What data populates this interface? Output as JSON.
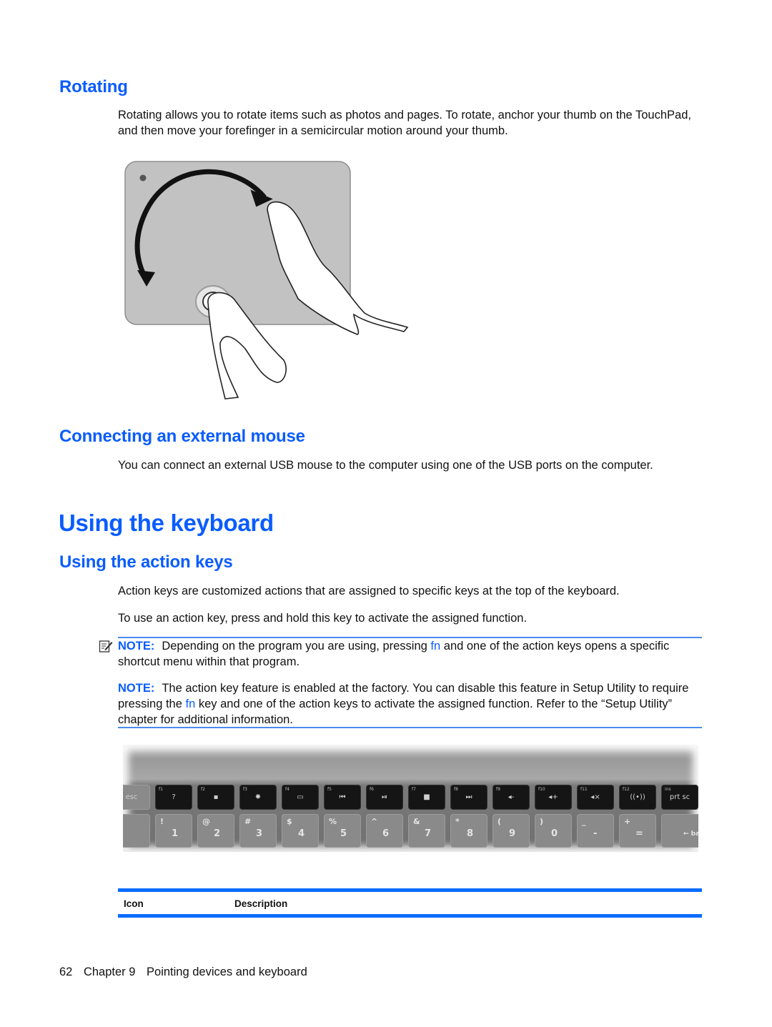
{
  "sections": {
    "rotating": {
      "heading": "Rotating",
      "body": "Rotating allows you to rotate items such as photos and pages. To rotate, anchor your thumb on the TouchPad, and then move your forefinger in a semicircular motion around your thumb.",
      "illustration": "touchpad-rotate-gesture"
    },
    "external_mouse": {
      "heading": "Connecting an external mouse",
      "body": "You can connect an external USB mouse to the computer using one of the USB ports on the computer."
    },
    "keyboard": {
      "title": "Using the keyboard"
    },
    "action_keys": {
      "heading": "Using the action keys",
      "para1": "Action keys are customized actions that are assigned to specific keys at the top of the keyboard.",
      "para2": "To use an action key, press and hold this key to activate the assigned function.",
      "note1": {
        "label": "NOTE:",
        "text_before": "Depending on the program you are using, pressing ",
        "fn": "fn",
        "text_after": " and one of the action keys opens a specific shortcut menu within that program."
      },
      "note2": {
        "label": "NOTE:",
        "text_before": "The action key feature is enabled at the factory. You can disable this feature in Setup Utility to require pressing the ",
        "fn": "fn",
        "text_after": " key and one of the action keys to activate the assigned function. Refer to the “Setup Utility” chapter for additional information."
      }
    }
  },
  "keyboard_image": {
    "function_keys": [
      {
        "label": "esc",
        "icon": "esc"
      },
      {
        "label": "f1",
        "icon": "?"
      },
      {
        "label": "f2",
        "icon": "▪"
      },
      {
        "label": "f3",
        "icon": "✹"
      },
      {
        "label": "f4",
        "icon": "▭"
      },
      {
        "label": "f5",
        "icon": "⏮"
      },
      {
        "label": "f6",
        "icon": "⏯"
      },
      {
        "label": "f7",
        "icon": "■"
      },
      {
        "label": "f8",
        "icon": "⏭"
      },
      {
        "label": "f9",
        "icon": "◂-"
      },
      {
        "label": "f10",
        "icon": "◂+"
      },
      {
        "label": "f11",
        "icon": "◂×"
      },
      {
        "label": "f12",
        "icon": "((•))"
      },
      {
        "label": "ins",
        "icon": "prt sc"
      }
    ],
    "number_keys": [
      {
        "top": "",
        "bottom": ""
      },
      {
        "top": "!",
        "bottom": "1"
      },
      {
        "top": "@",
        "bottom": "2"
      },
      {
        "top": "#",
        "bottom": "3"
      },
      {
        "top": "$",
        "bottom": "4"
      },
      {
        "top": "%",
        "bottom": "5"
      },
      {
        "top": "^",
        "bottom": "6"
      },
      {
        "top": "&",
        "bottom": "7"
      },
      {
        "top": "*",
        "bottom": "8"
      },
      {
        "top": "(",
        "bottom": "9"
      },
      {
        "top": ")",
        "bottom": "0"
      },
      {
        "top": "_",
        "bottom": "-"
      },
      {
        "top": "+",
        "bottom": "="
      },
      {
        "top": "",
        "bottom": "← backsp"
      }
    ]
  },
  "table": {
    "headers": [
      "Icon",
      "Description"
    ]
  },
  "footer": {
    "page_number": "62",
    "chapter": "Chapter 9",
    "chapter_title": "Pointing devices and keyboard"
  }
}
